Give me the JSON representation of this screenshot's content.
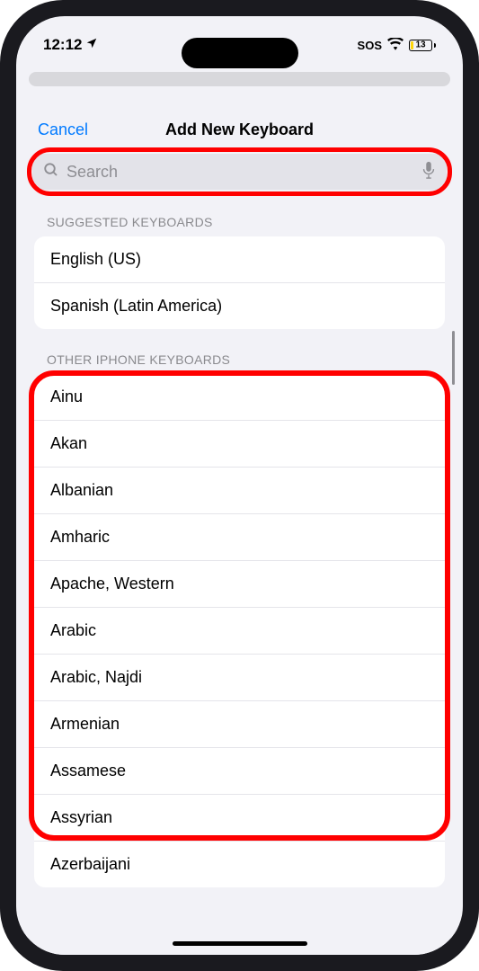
{
  "status": {
    "time": "12:12",
    "sos": "SOS",
    "battery": "13"
  },
  "sheet": {
    "cancel": "Cancel",
    "title": "Add New Keyboard"
  },
  "search": {
    "placeholder": "Search"
  },
  "sections": {
    "suggested": {
      "header": "SUGGESTED KEYBOARDS",
      "items": [
        "English (US)",
        "Spanish (Latin America)"
      ]
    },
    "other": {
      "header": "OTHER IPHONE KEYBOARDS",
      "items": [
        "Ainu",
        "Akan",
        "Albanian",
        "Amharic",
        "Apache, Western",
        "Arabic",
        "Arabic, Najdi",
        "Armenian",
        "Assamese",
        "Assyrian",
        "Azerbaijani"
      ]
    }
  }
}
